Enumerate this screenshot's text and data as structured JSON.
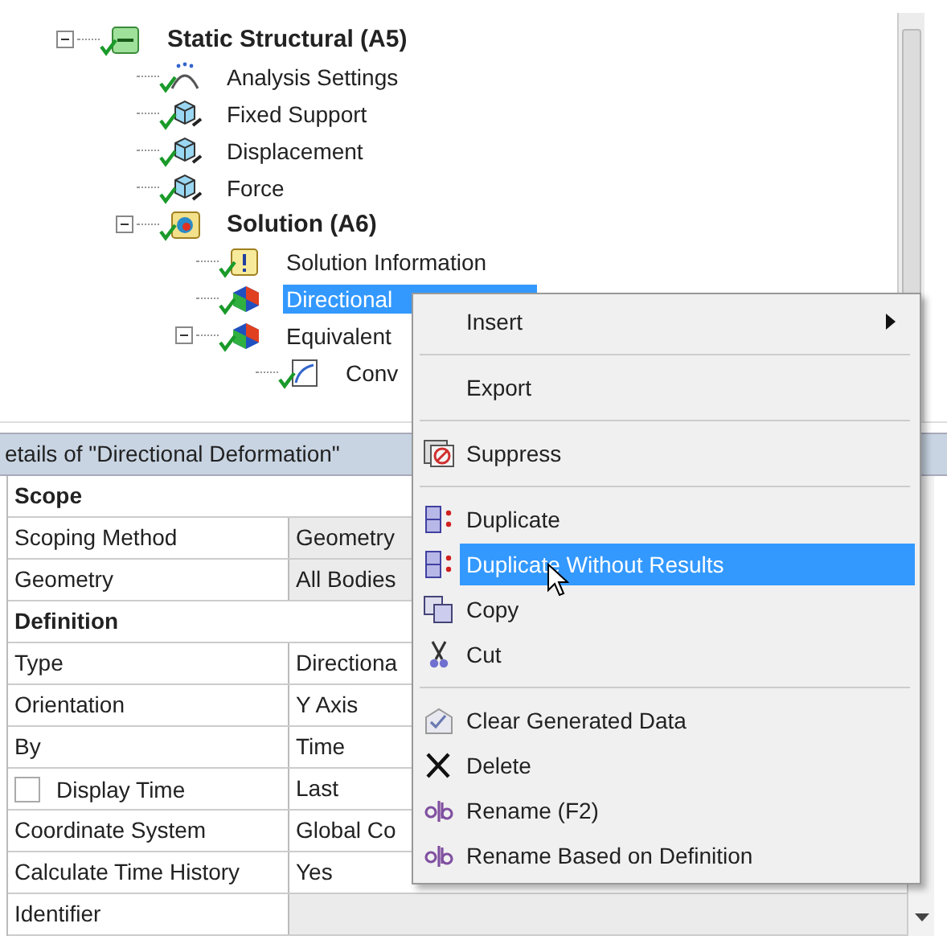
{
  "tree": [
    {
      "label": "Static Structural (A5)",
      "kind": "analysis",
      "expanded": true,
      "selected": false,
      "children": [
        {
          "label": "Analysis Settings",
          "kind": "settings",
          "selected": false
        },
        {
          "label": "Fixed Support",
          "kind": "support",
          "selected": false
        },
        {
          "label": "Displacement",
          "kind": "displacement",
          "selected": false
        },
        {
          "label": "Force",
          "kind": "force",
          "selected": false
        },
        {
          "label": "Solution (A6)",
          "kind": "solution",
          "expanded": true,
          "selected": false,
          "children": [
            {
              "label": "Solution Information",
              "kind": "info",
              "selected": false
            },
            {
              "label": "Directional",
              "kind": "result",
              "selected": true
            },
            {
              "label": "Equivalent",
              "kind": "result",
              "expanded": true,
              "selected": false,
              "children": [
                {
                  "label": "Conv",
                  "kind": "convergence",
                  "selected": false
                }
              ]
            }
          ]
        }
      ]
    }
  ],
  "details": {
    "title": "etails of \"Directional Deformation\"",
    "rows": [
      {
        "kind": "section",
        "label": "Scope"
      },
      {
        "kind": "property",
        "label": "Scoping Method",
        "value": "Geometry",
        "shaded": true
      },
      {
        "kind": "property",
        "label": "Geometry",
        "value": "All Bodies",
        "shaded": true
      },
      {
        "kind": "section",
        "label": "Definition"
      },
      {
        "kind": "property",
        "label": "Type",
        "value": "Directiona",
        "shaded": false
      },
      {
        "kind": "property",
        "label": "Orientation",
        "value": "Y Axis",
        "shaded": false
      },
      {
        "kind": "property",
        "label": "By",
        "value": "Time",
        "shaded": false
      },
      {
        "kind": "checkbox",
        "label": "Display Time",
        "checked": false,
        "value": "Last",
        "shaded": false
      },
      {
        "kind": "property",
        "label": "Coordinate System",
        "value": "Global Co",
        "shaded": false
      },
      {
        "kind": "property",
        "label": "Calculate Time History",
        "value": "Yes",
        "shaded": false
      },
      {
        "kind": "property",
        "label": "Identifier",
        "shaded": true
      }
    ]
  },
  "context_menu": [
    {
      "kind": "plain",
      "label": "Insert",
      "submenu": true,
      "selected": false
    },
    {
      "kind": "separator"
    },
    {
      "kind": "plain",
      "label": "Export",
      "submenu": false,
      "selected": false
    },
    {
      "kind": "separator"
    },
    {
      "kind": "suppress",
      "label": "Suppress",
      "submenu": false,
      "selected": false
    },
    {
      "kind": "separator"
    },
    {
      "kind": "duplicate",
      "label": "Duplicate",
      "submenu": false,
      "selected": false
    },
    {
      "kind": "duplicate",
      "label": "Duplicate Without Results",
      "submenu": false,
      "selected": true
    },
    {
      "kind": "copy",
      "label": "Copy",
      "submenu": false,
      "selected": false
    },
    {
      "kind": "cut",
      "label": "Cut",
      "submenu": false,
      "selected": false
    },
    {
      "kind": "separator"
    },
    {
      "kind": "clear",
      "label": "Clear Generated Data",
      "submenu": false,
      "selected": false
    },
    {
      "kind": "delete",
      "label": "Delete",
      "submenu": false,
      "selected": false
    },
    {
      "kind": "rename",
      "label": "Rename (F2)",
      "submenu": false,
      "selected": false
    },
    {
      "kind": "rename",
      "label": "Rename Based on Definition",
      "submenu": false,
      "selected": false
    }
  ]
}
